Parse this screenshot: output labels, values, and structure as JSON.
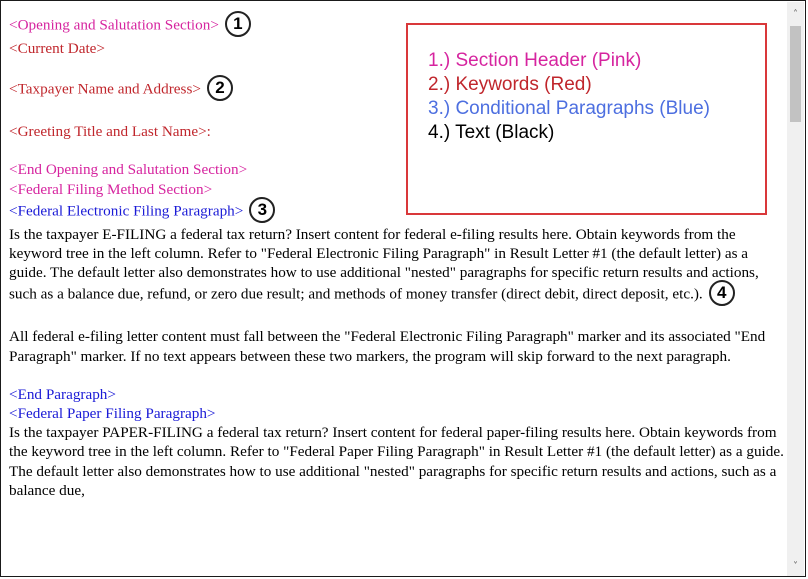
{
  "doc": {
    "line1": "<Opening and Salutation Section>",
    "line2": "<Current Date>",
    "line3": "<Taxpayer Name and Address>",
    "line4": "<Greeting Title and Last Name>:",
    "line5": "<End Opening and Salutation Section>",
    "line6": "<Federal Filing Method Section>",
    "line7": "<Federal Electronic Filing Paragraph>",
    "para1": "Is the taxpayer E-FILING a federal tax return? Insert content for federal e-filing results here. Obtain keywords from the keyword tree in the left column. Refer to \"Federal Electronic Filing Paragraph\" in Result Letter #1 (the default letter) as a guide. The default letter also demonstrates how to use additional \"nested\" paragraphs for specific return results and actions, such as a balance due, refund, or zero due result; and methods of money transfer (direct debit, direct deposit, etc.).",
    "para2": "All federal e-filing letter content must fall between the \"Federal Electronic Filing Paragraph\" marker and its associated \"End Paragraph\" marker. If no text appears between these two markers, the program will skip forward to the next paragraph.",
    "line8": "<End Paragraph>",
    "line9": "<Federal Paper Filing Paragraph>",
    "para3": "Is the taxpayer PAPER-FILING a federal tax return? Insert content for federal paper-filing results here. Obtain keywords from the keyword tree in the left column. Refer to \"Federal Paper Filing Paragraph\" in Result Letter #1 (the default letter) as a guide. The default letter also demonstrates how to use additional \"nested\" paragraphs for specific return results and actions, such as a balance due,"
  },
  "markers": {
    "m1": "1",
    "m2": "2",
    "m3": "3",
    "m4": "4"
  },
  "legend": {
    "item1": "1.) Section Header (Pink)",
    "item2": "2.) Keywords (Red)",
    "item3": "3.) Conditional Paragraphs (Blue)",
    "item4": "4.) Text (Black)"
  },
  "scrollbar": {
    "up_icon": "chevron-up-icon",
    "down_icon": "chevron-down-icon"
  },
  "colors": {
    "section_header": "#d6249f",
    "keyword": "#c0262c",
    "conditional": "#1a1ad6",
    "text": "#000000",
    "legend_border": "#d9383a"
  }
}
